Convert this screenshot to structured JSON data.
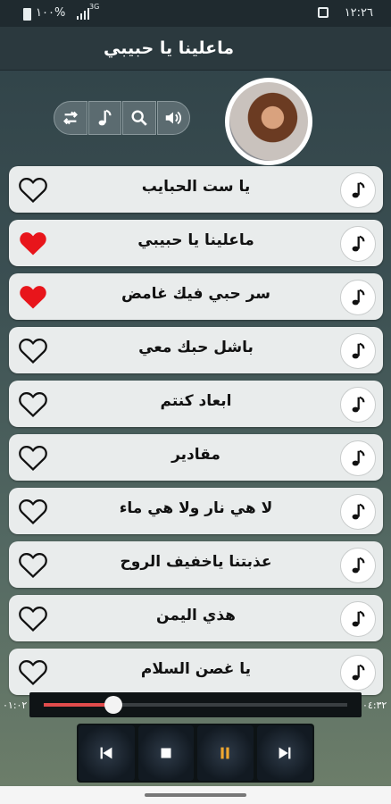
{
  "status_bar": {
    "time": "١٢:٢٦",
    "battery": "١٠٠%",
    "network": "3G"
  },
  "header": {
    "title": "ماعلينا يا حبيبي"
  },
  "toolbar": {
    "icons": [
      "repeat-icon",
      "music-note-icon",
      "search-icon",
      "volume-icon"
    ]
  },
  "songs": [
    {
      "title": "يا ست الحبايب",
      "favorite": false
    },
    {
      "title": "ماعلينا يا حبيبي",
      "favorite": true
    },
    {
      "title": "سر حبي فيك غامض",
      "favorite": true
    },
    {
      "title": "باشل حبك معي",
      "favorite": false
    },
    {
      "title": "ابعاد كنتم",
      "favorite": false
    },
    {
      "title": "مقادير",
      "favorite": false
    },
    {
      "title": "لا هي نار ولا هي ماء",
      "favorite": false
    },
    {
      "title": "عذبتنا ياخفيف الروح",
      "favorite": false
    },
    {
      "title": "هذي اليمن",
      "favorite": false
    },
    {
      "title": "يا غصن السلام",
      "favorite": false
    }
  ],
  "player": {
    "elapsed": "٠١:٠٢",
    "duration": "٠٤:٣٢",
    "progress_fraction": 0.23
  },
  "colors": {
    "accent": "#e14c4c",
    "heart_filled": "#e8151b",
    "pause": "#f0a830"
  }
}
